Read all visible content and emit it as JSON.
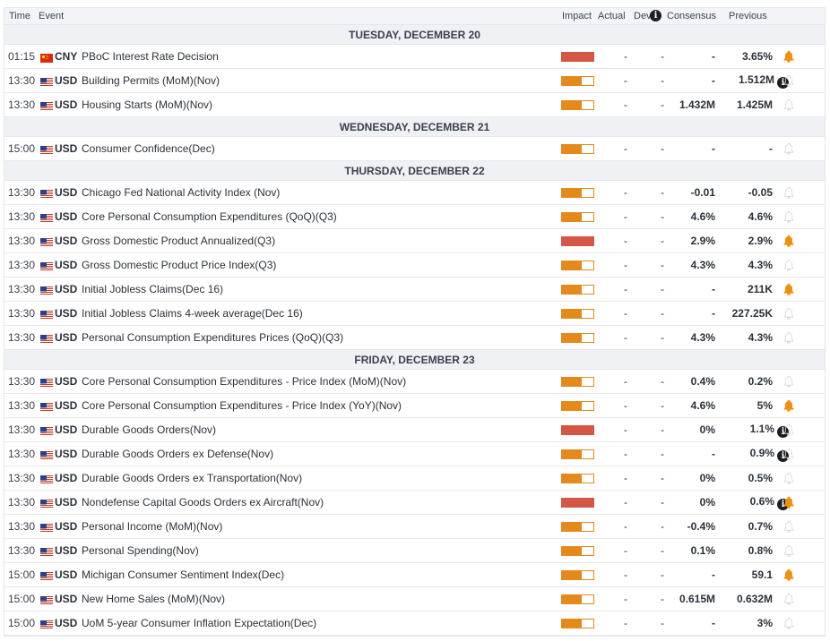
{
  "header": {
    "time": "Time",
    "event": "Event",
    "impact": "Impact",
    "actual": "Actual",
    "dev": "Dev",
    "consensus": "Consensus",
    "previous": "Previous"
  },
  "colors": {
    "high": "#d45746",
    "medium": "#e48a1c",
    "bell_active": "#f0900f",
    "bell_inactive": "#d8d9dc"
  },
  "days": [
    {
      "label": "TUESDAY, DECEMBER 20",
      "events": [
        {
          "time": "01:15",
          "country": "CNY",
          "event": "PBoC Interest Rate Decision",
          "impact": "high",
          "actual": "-",
          "dev": "-",
          "consensus": "-",
          "previous": "3.65%",
          "info": false,
          "alert": true
        },
        {
          "time": "13:30",
          "country": "USD",
          "event": "Building Permits (MoM)(Nov)",
          "impact": "medium",
          "actual": "-",
          "dev": "-",
          "consensus": "-",
          "previous": "1.512M",
          "info": true,
          "alert": false
        },
        {
          "time": "13:30",
          "country": "USD",
          "event": "Housing Starts (MoM)(Nov)",
          "impact": "medium",
          "actual": "-",
          "dev": "-",
          "consensus": "1.432M",
          "previous": "1.425M",
          "info": false,
          "alert": false
        }
      ]
    },
    {
      "label": "WEDNESDAY, DECEMBER 21",
      "events": [
        {
          "time": "15:00",
          "country": "USD",
          "event": "Consumer Confidence(Dec)",
          "impact": "medium",
          "actual": "-",
          "dev": "-",
          "consensus": "-",
          "previous": "-",
          "info": false,
          "alert": false
        }
      ]
    },
    {
      "label": "THURSDAY, DECEMBER 22",
      "events": [
        {
          "time": "13:30",
          "country": "USD",
          "event": "Chicago Fed National Activity Index (Nov)",
          "impact": "medium",
          "actual": "-",
          "dev": "-",
          "consensus": "-0.01",
          "previous": "-0.05",
          "info": false,
          "alert": false
        },
        {
          "time": "13:30",
          "country": "USD",
          "event": "Core Personal Consumption Expenditures (QoQ)(Q3)",
          "impact": "medium",
          "actual": "-",
          "dev": "-",
          "consensus": "4.6%",
          "previous": "4.6%",
          "info": false,
          "alert": false
        },
        {
          "time": "13:30",
          "country": "USD",
          "event": "Gross Domestic Product Annualized(Q3)",
          "impact": "high",
          "actual": "-",
          "dev": "-",
          "consensus": "2.9%",
          "previous": "2.9%",
          "info": false,
          "alert": true
        },
        {
          "time": "13:30",
          "country": "USD",
          "event": "Gross Domestic Product Price Index(Q3)",
          "impact": "medium",
          "actual": "-",
          "dev": "-",
          "consensus": "4.3%",
          "previous": "4.3%",
          "info": false,
          "alert": false
        },
        {
          "time": "13:30",
          "country": "USD",
          "event": "Initial Jobless Claims(Dec 16)",
          "impact": "medium",
          "actual": "-",
          "dev": "-",
          "consensus": "-",
          "previous": "211K",
          "info": false,
          "alert": true
        },
        {
          "time": "13:30",
          "country": "USD",
          "event": "Initial Jobless Claims 4-week average(Dec 16)",
          "impact": "medium",
          "actual": "-",
          "dev": "-",
          "consensus": "-",
          "previous": "227.25K",
          "info": false,
          "alert": false
        },
        {
          "time": "13:30",
          "country": "USD",
          "event": "Personal Consumption Expenditures Prices (QoQ)(Q3)",
          "impact": "medium",
          "actual": "-",
          "dev": "-",
          "consensus": "4.3%",
          "previous": "4.3%",
          "info": false,
          "alert": false
        }
      ]
    },
    {
      "label": "FRIDAY, DECEMBER 23",
      "events": [
        {
          "time": "13:30",
          "country": "USD",
          "event": "Core Personal Consumption Expenditures - Price Index (MoM)(Nov)",
          "impact": "medium",
          "actual": "-",
          "dev": "-",
          "consensus": "0.4%",
          "previous": "0.2%",
          "info": false,
          "alert": false
        },
        {
          "time": "13:30",
          "country": "USD",
          "event": "Core Personal Consumption Expenditures - Price Index (YoY)(Nov)",
          "impact": "medium",
          "actual": "-",
          "dev": "-",
          "consensus": "4.6%",
          "previous": "5%",
          "info": false,
          "alert": true
        },
        {
          "time": "13:30",
          "country": "USD",
          "event": "Durable Goods Orders(Nov)",
          "impact": "high",
          "actual": "-",
          "dev": "-",
          "consensus": "0%",
          "previous": "1.1%",
          "info": true,
          "alert": false
        },
        {
          "time": "13:30",
          "country": "USD",
          "event": "Durable Goods Orders ex Defense(Nov)",
          "impact": "medium",
          "actual": "-",
          "dev": "-",
          "consensus": "-",
          "previous": "0.9%",
          "info": true,
          "alert": false
        },
        {
          "time": "13:30",
          "country": "USD",
          "event": "Durable Goods Orders ex Transportation(Nov)",
          "impact": "medium",
          "actual": "-",
          "dev": "-",
          "consensus": "0%",
          "previous": "0.5%",
          "info": false,
          "alert": false
        },
        {
          "time": "13:30",
          "country": "USD",
          "event": "Nondefense Capital Goods Orders ex Aircraft(Nov)",
          "impact": "high",
          "actual": "-",
          "dev": "-",
          "consensus": "0%",
          "previous": "0.6%",
          "info": true,
          "alert": true
        },
        {
          "time": "13:30",
          "country": "USD",
          "event": "Personal Income (MoM)(Nov)",
          "impact": "medium",
          "actual": "-",
          "dev": "-",
          "consensus": "-0.4%",
          "previous": "0.7%",
          "info": false,
          "alert": false
        },
        {
          "time": "13:30",
          "country": "USD",
          "event": "Personal Spending(Nov)",
          "impact": "medium",
          "actual": "-",
          "dev": "-",
          "consensus": "0.1%",
          "previous": "0.8%",
          "info": false,
          "alert": false
        },
        {
          "time": "15:00",
          "country": "USD",
          "event": "Michigan Consumer Sentiment Index(Dec)",
          "impact": "medium",
          "actual": "-",
          "dev": "-",
          "consensus": "-",
          "previous": "59.1",
          "info": false,
          "alert": true
        },
        {
          "time": "15:00",
          "country": "USD",
          "event": "New Home Sales (MoM)(Nov)",
          "impact": "medium",
          "actual": "-",
          "dev": "-",
          "consensus": "0.615M",
          "previous": "0.632M",
          "info": false,
          "alert": false
        },
        {
          "time": "15:00",
          "country": "USD",
          "event": "UoM 5-year Consumer Inflation Expectation(Dec)",
          "impact": "medium",
          "actual": "-",
          "dev": "-",
          "consensus": "-",
          "previous": "3%",
          "info": false,
          "alert": false
        }
      ]
    }
  ]
}
